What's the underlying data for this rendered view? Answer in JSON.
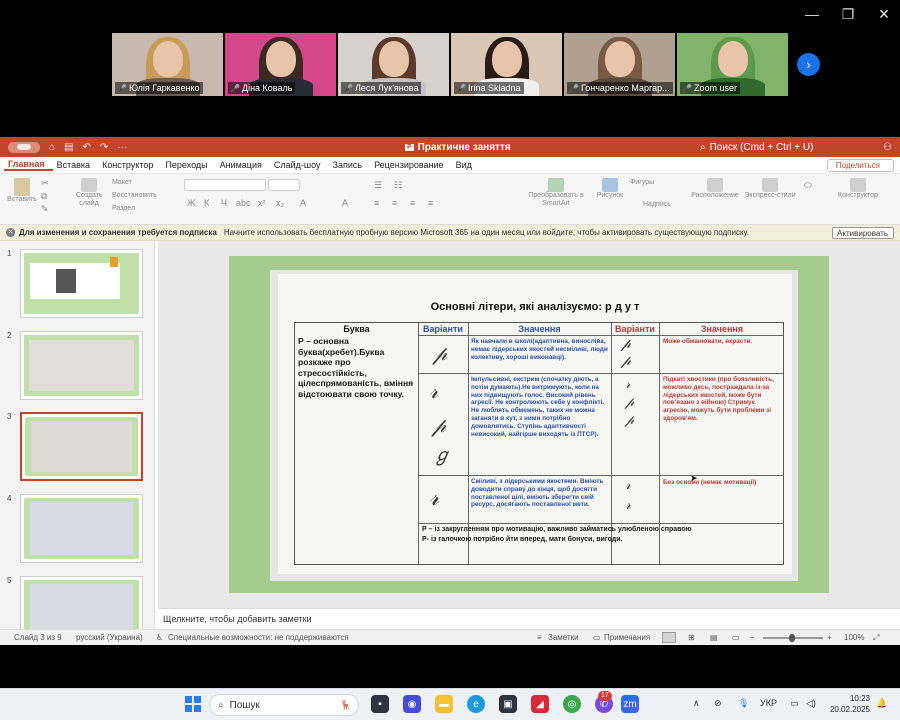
{
  "participants": [
    {
      "name": "Юлія Гаркавенко",
      "active": false,
      "bg": "#c7b9ad",
      "hair": "#c89b58",
      "body": "#6b5e58"
    },
    {
      "name": "Діна Коваль",
      "active": true,
      "bg": "#d4468a",
      "hair": "#3a2a22",
      "body": "#2a2a35"
    },
    {
      "name": "Леся Лук'янова",
      "active": false,
      "bg": "#d8d2cc",
      "hair": "#5a3a2a",
      "body": "#c4c0c4"
    },
    {
      "name": "Irina Skladna",
      "active": false,
      "bg": "#d9c7b3",
      "hair": "#2a1a16",
      "body": "#efefef"
    },
    {
      "name": "Гончаренко Маргар...",
      "active": false,
      "bg": "#b0a090",
      "hair": "#7a5a44",
      "body": "#5a4a40"
    },
    {
      "name": "Zoom user",
      "active": false,
      "bg": "#7fb46a",
      "hair": "#5e9a4e",
      "body": "#2f6b2c"
    }
  ],
  "ppt": {
    "title": "Практичне заняття",
    "search": "Поиск (Cmd + Ctrl + U)",
    "menu": [
      "Главная",
      "Вставка",
      "Конструктор",
      "Переходы",
      "Анимация",
      "Слайд-шоу",
      "Запись",
      "Рецензирование",
      "Вид"
    ],
    "share": "Поделиться",
    "ribbon": {
      "paste": "Вставить",
      "new_slide": "Создать слайд",
      "layout": "Макет",
      "reset": "Восстановить",
      "section": "Раздел",
      "smartart": "Преобразовать в SmartArt",
      "picture": "Рисунок",
      "shapes": "Фигуры",
      "textbox": "Надпись",
      "arrange": "Расположение",
      "quick_styles": "Экспресс-стили",
      "designer": "Конструктор"
    },
    "notify_bold": "Для изменения и сохранения требуется подписка",
    "notify_text": "Начните использовать бесплатную пробную версию Microsoft 365 на один месяц или войдите, чтобы активировать существующую подписку.",
    "activate": "Активировать",
    "slide_numbers": [
      "1",
      "2",
      "3",
      "4",
      "5"
    ],
    "notes_placeholder": "Щелкните, чтобы добавить заметки",
    "status": {
      "slide_of": "Слайд 3 из 9",
      "language": "русский (Украина)",
      "accessibility": "Специальные возможности: не поддерживаются",
      "notes": "Заметки",
      "comments": "Примечания",
      "zoom": "100%"
    }
  },
  "slide": {
    "heading": "Основні літери, які аналізуємо: р д у т",
    "col_headers": [
      "Буква",
      "Варіанти",
      "Значення",
      "Варіанти",
      "Значення"
    ],
    "letter_desc": "Р – основна буква(хребет).Буква розкаже про стресостійкість, цілеспрямованість, вміння відстоювати свою точку.",
    "r1_meaning": "Як навчали в школі(адаптивна, виносліва, немає лідерських якостей несміливі, люди колективу, хороші виконавці).",
    "r2_meaning": "Імпульсивні, екстрим (спочатку діють, а потім думають).Не витримують, коли на них підвищують голос. Високий рівень агресії. Не контролюють себе у конфлікті. Не люблять обмежень, таких не можна заганяти в кут, з ними потрібно домовлятись. Ступінь адаптивності невисокий, найгірше виходять із ПТСР).",
    "r3_meaning": "Сміливі, з лідерськими якостями. Вміють доводити справу до кінця, щоб досягти поставленої цілі, вміють зберегти свій ресурс, досягають поставленої мети.",
    "m1": "Може обманювати, вкрасти.",
    "m2": "Підкаті хвостики (про боязливість, можливо десь, постраждала із-за лідерських якостей, може бути пов'язано з війною) Стримує агресію, можуть бути проблеми зі здоров'ям.",
    "m3": "Без основи (немає мотивації)",
    "foot1": "Р – із закругленням про мотивацію, важливо займатись улюбленою справою",
    "foot2": "Р- із галочкою потрібно йти вперед, мати бонуси, вигоди."
  },
  "taskbar": {
    "search": "Пошук",
    "lang": "УКР",
    "time": "10:23",
    "date": "20.02.2025",
    "badge": "17"
  }
}
